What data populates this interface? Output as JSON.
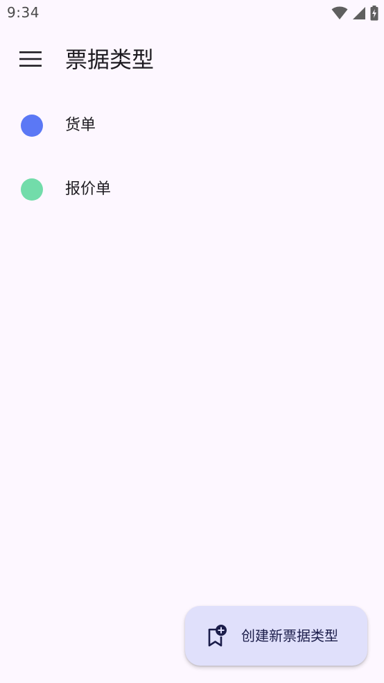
{
  "status_bar": {
    "time": "9:34"
  },
  "app_bar": {
    "title": "票据类型",
    "menu_icon": "hamburger-menu-icon"
  },
  "list": {
    "items": [
      {
        "label": "货单",
        "color": "#5b78f5"
      },
      {
        "label": "报价单",
        "color": "#72dcaa"
      }
    ]
  },
  "fab": {
    "label": "创建新票据类型",
    "icon": "bookmark-add-icon"
  },
  "colors": {
    "background": "#fdf7ff",
    "fab_background": "#e0e0fb",
    "text": "#1d1b20"
  }
}
